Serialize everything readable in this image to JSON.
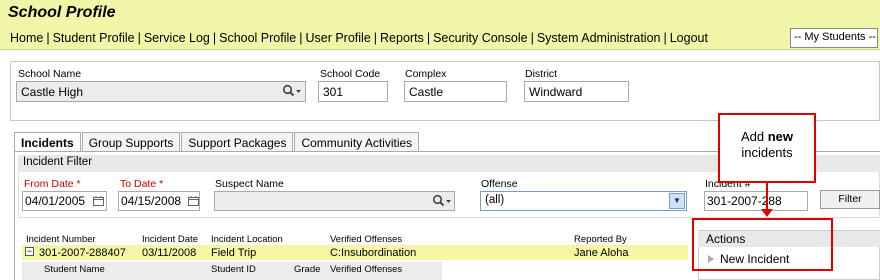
{
  "app": {
    "title": "School Profile"
  },
  "nav": {
    "items": [
      "Home",
      "Student Profile",
      "Service Log",
      "School Profile",
      "User Profile",
      "Reports",
      "Security Console",
      "System Administration",
      "Logout"
    ],
    "separator": "|"
  },
  "my_students": {
    "value": "-- My Students --"
  },
  "school": {
    "school_name_label": "School Name",
    "school_name_value": "Castle High",
    "school_code_label": "School Code",
    "school_code_value": "301",
    "complex_label": "Complex",
    "complex_value": "Castle",
    "district_label": "District",
    "district_value": "Windward"
  },
  "tabs": [
    {
      "label": "Incidents",
      "active": true
    },
    {
      "label": "Group Supports",
      "active": false
    },
    {
      "label": "Support Packages",
      "active": false
    },
    {
      "label": "Community Activities",
      "active": false
    }
  ],
  "filter": {
    "header": "Incident Filter",
    "from_date_label": "From Date",
    "from_date_value": "04/01/2005",
    "to_date_label": "To Date",
    "to_date_value": "04/15/2008",
    "required_mark": "*",
    "suspect_name_label": "Suspect Name",
    "suspect_name_value": "",
    "offense_label": "Offense",
    "offense_value": "(all)",
    "incident_no_label": "Incident #",
    "incident_no_value": "301-2007-288",
    "filter_button": "Filter"
  },
  "grid": {
    "columns": [
      "Incident Number",
      "Incident Date",
      "Incident Location",
      "Verified Offenses",
      "Reported By"
    ],
    "rows": [
      {
        "incident_number": "301-2007-288407",
        "incident_date": "03/11/2008",
        "incident_location": "Field Trip",
        "verified_offenses": "C:Insubordination",
        "reported_by": "Jane Aloha"
      }
    ],
    "sub_columns": [
      "Student Name",
      "Student ID",
      "Grade",
      "Verified Offenses"
    ],
    "expander_symbol": "−"
  },
  "actions": {
    "title": "Actions",
    "items": [
      "New Incident"
    ]
  },
  "callout": {
    "text_pre": "Add ",
    "text_bold": "new",
    "text_post": "incidents"
  },
  "icons": {
    "search": "magnifier-dropdown-icon",
    "calendar": "calendar-icon",
    "dropdown": "dropdown-arrow-icon",
    "bullet": "triangle-bullet-icon"
  },
  "colors": {
    "topbar": "#f0f5a8",
    "highlight_row": "#f6f6a4",
    "required": "#cc0000",
    "callout_border": "#e00000"
  }
}
